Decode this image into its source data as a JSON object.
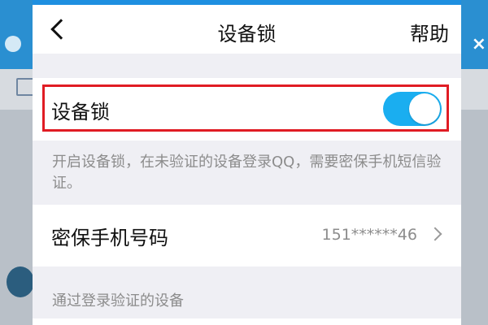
{
  "background": {
    "close_glyph": "×"
  },
  "nav": {
    "title": "设备锁",
    "help": "帮助"
  },
  "device_lock": {
    "label": "设备锁",
    "enabled": true,
    "hint": "开启设备锁，在未验证的设备登录QQ，需要密保手机短信验证。"
  },
  "phone": {
    "label": "密保手机号码",
    "value": "151******46"
  },
  "section": {
    "verified_devices_label": "通过登录验证的设备"
  },
  "colors": {
    "accent": "#1aaef0",
    "highlight_border": "#e01c24",
    "background_app": "#2a8fd1"
  }
}
